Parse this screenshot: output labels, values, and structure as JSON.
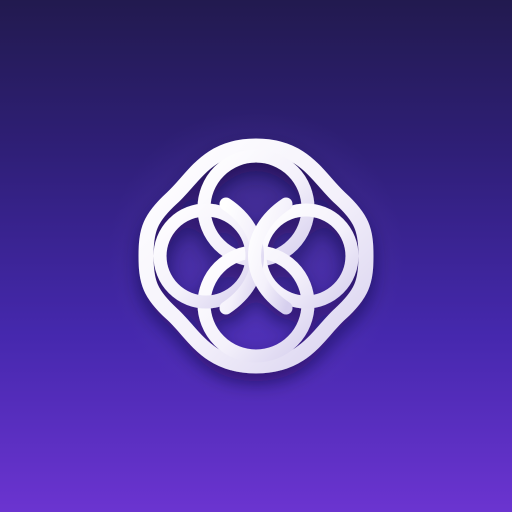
{
  "logo": {
    "icon": "interlocking-rings-logo-icon",
    "colors": {
      "ring_light": "#ffffff",
      "ring_shade": "#dcd6f2",
      "shadow": "#140b3a"
    }
  },
  "background": {
    "colors": {
      "top": "#221a4f",
      "mid": "#4528ad",
      "bottom": "#6b34d0"
    }
  }
}
